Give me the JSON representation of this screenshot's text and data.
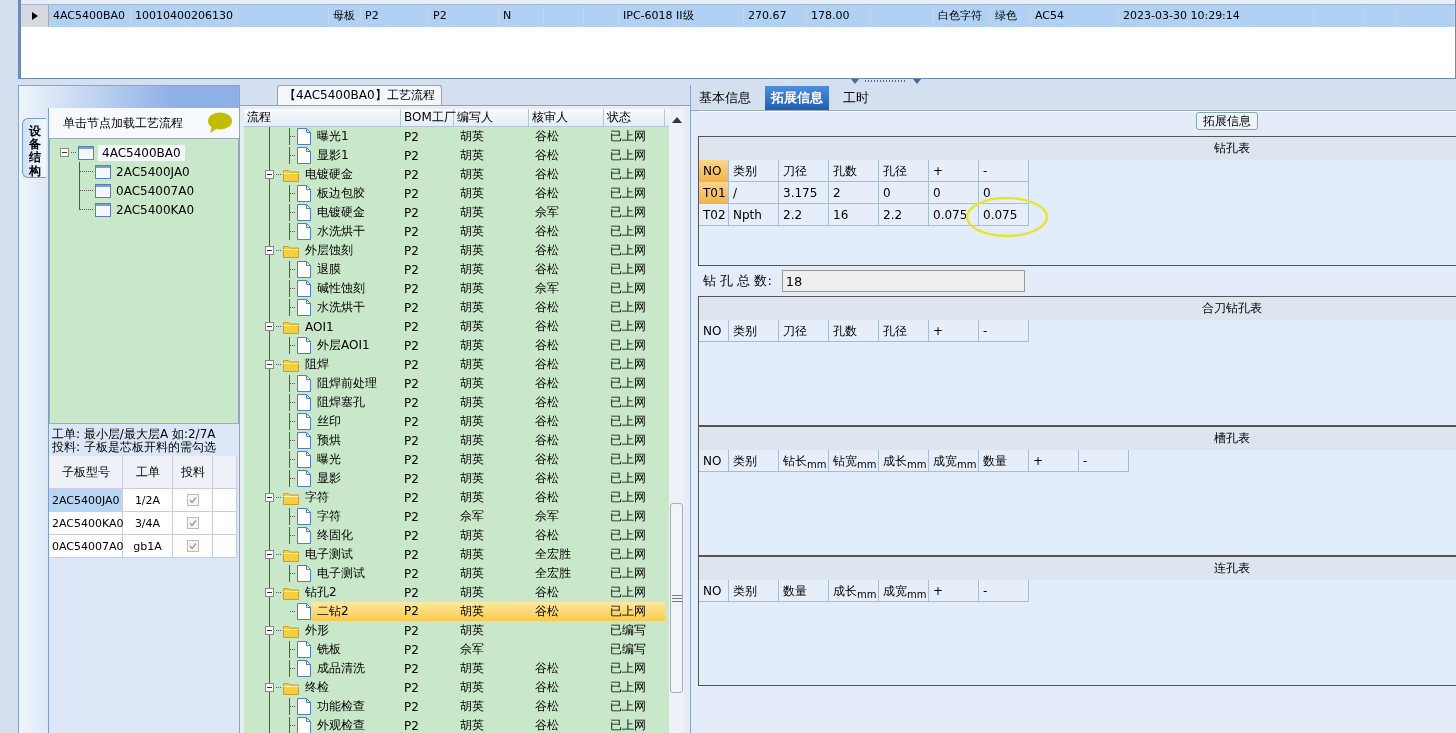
{
  "top_grid": {
    "rows": [
      {
        "selected": true,
        "cells": [
          "4AC5400BA0",
          "10010400206130",
          null,
          "母板",
          "P2",
          "P2",
          "N",
          null,
          null,
          "IPC-6018 II级",
          "270.67",
          "178.00",
          null,
          "白色字符",
          "绿色",
          "AC54",
          "2023-03-30 10:29:14",
          null,
          null,
          null
        ]
      }
    ]
  },
  "left_panel": {
    "vertical_tab": "设备结构",
    "hint": "单击节点加载工艺流程",
    "tree": {
      "label": "4AC5400BA0",
      "expanded": true,
      "children": [
        {
          "label": "2AC5400JA0"
        },
        {
          "label": "0AC54007A0"
        },
        {
          "label": "2AC5400KA0"
        }
      ]
    },
    "notes": [
      "工单: 最小层/最大层A 如:2/7A",
      "投料: 子板是芯板开料的需勾选"
    ],
    "sub_table": {
      "columns": [
        "子板型号",
        "工单",
        "投料"
      ],
      "rows": [
        {
          "model": "2AC5400JA0",
          "order": "1/2A",
          "checked": true,
          "selected": true
        },
        {
          "model": "2AC5400KA0",
          "order": "3/4A",
          "checked": true,
          "selected": false
        },
        {
          "model": "0AC54007A0",
          "order": "gb1A",
          "checked": true,
          "selected": false
        }
      ]
    }
  },
  "process": {
    "title": "【4AC5400BA0】工艺流程",
    "columns": [
      "流程",
      "BOM工厂",
      "编写人",
      "核审人",
      "状态"
    ],
    "rows": [
      {
        "kind": "file",
        "label": "曝光1",
        "bom": "P2",
        "writer": "胡英",
        "reviewer": "谷松",
        "status": "已上网",
        "selected": false
      },
      {
        "kind": "file",
        "label": "显影1",
        "bom": "P2",
        "writer": "胡英",
        "reviewer": "谷松",
        "status": "已上网",
        "selected": false
      },
      {
        "kind": "folder",
        "label": "电镀硬金",
        "bom": "P2",
        "writer": "胡英",
        "reviewer": "谷松",
        "status": "已上网",
        "selected": false,
        "expanded": true,
        "children": [
          {
            "kind": "file",
            "label": "板边包胶",
            "bom": "P2",
            "writer": "胡英",
            "reviewer": "谷松",
            "status": "已上网",
            "selected": false
          },
          {
            "kind": "file",
            "label": "电镀硬金",
            "bom": "P2",
            "writer": "胡英",
            "reviewer": "佘军",
            "status": "已上网",
            "selected": false
          },
          {
            "kind": "file",
            "label": "水洗烘干",
            "bom": "P2",
            "writer": "胡英",
            "reviewer": "谷松",
            "status": "已上网",
            "selected": false
          }
        ]
      },
      {
        "kind": "folder",
        "label": "外层蚀刻",
        "bom": "P2",
        "writer": "胡英",
        "reviewer": "谷松",
        "status": "已上网",
        "selected": false,
        "expanded": true,
        "children": [
          {
            "kind": "file",
            "label": "退膜",
            "bom": "P2",
            "writer": "胡英",
            "reviewer": "谷松",
            "status": "已上网",
            "selected": false
          },
          {
            "kind": "file",
            "label": "碱性蚀刻",
            "bom": "P2",
            "writer": "胡英",
            "reviewer": "佘军",
            "status": "已上网",
            "selected": false
          },
          {
            "kind": "file",
            "label": "水洗烘干",
            "bom": "P2",
            "writer": "胡英",
            "reviewer": "谷松",
            "status": "已上网",
            "selected": false
          }
        ]
      },
      {
        "kind": "folder",
        "label": "AOI1",
        "bom": "P2",
        "writer": "胡英",
        "reviewer": "谷松",
        "status": "已上网",
        "selected": false,
        "expanded": true,
        "children": [
          {
            "kind": "file",
            "label": "外层AOI1",
            "bom": "P2",
            "writer": "胡英",
            "reviewer": "谷松",
            "status": "已上网",
            "selected": false
          }
        ]
      },
      {
        "kind": "folder",
        "label": "阻焊",
        "bom": "P2",
        "writer": "胡英",
        "reviewer": "谷松",
        "status": "已上网",
        "selected": false,
        "expanded": true,
        "children": [
          {
            "kind": "file",
            "label": "阻焊前处理",
            "bom": "P2",
            "writer": "胡英",
            "reviewer": "谷松",
            "status": "已上网",
            "selected": false
          },
          {
            "kind": "file",
            "label": "阻焊塞孔",
            "bom": "P2",
            "writer": "胡英",
            "reviewer": "谷松",
            "status": "已上网",
            "selected": false
          },
          {
            "kind": "file",
            "label": "丝印",
            "bom": "P2",
            "writer": "胡英",
            "reviewer": "谷松",
            "status": "已上网",
            "selected": false
          },
          {
            "kind": "file",
            "label": "预烘",
            "bom": "P2",
            "writer": "胡英",
            "reviewer": "谷松",
            "status": "已上网",
            "selected": false
          },
          {
            "kind": "file",
            "label": "曝光",
            "bom": "P2",
            "writer": "胡英",
            "reviewer": "谷松",
            "status": "已上网",
            "selected": false
          },
          {
            "kind": "file",
            "label": "显影",
            "bom": "P2",
            "writer": "胡英",
            "reviewer": "谷松",
            "status": "已上网",
            "selected": false
          }
        ]
      },
      {
        "kind": "folder",
        "label": "字符",
        "bom": "P2",
        "writer": "胡英",
        "reviewer": "谷松",
        "status": "已上网",
        "selected": false,
        "expanded": true,
        "children": [
          {
            "kind": "file",
            "label": "字符",
            "bom": "P2",
            "writer": "佘军",
            "reviewer": "佘军",
            "status": "已上网",
            "selected": false
          },
          {
            "kind": "file",
            "label": "终固化",
            "bom": "P2",
            "writer": "胡英",
            "reviewer": "谷松",
            "status": "已上网",
            "selected": false
          }
        ]
      },
      {
        "kind": "folder",
        "label": "电子测试",
        "bom": "P2",
        "writer": "胡英",
        "reviewer": "全宏胜",
        "status": "已上网",
        "selected": false,
        "expanded": true,
        "children": [
          {
            "kind": "file",
            "label": "电子测试",
            "bom": "P2",
            "writer": "胡英",
            "reviewer": "全宏胜",
            "status": "已上网",
            "selected": false
          }
        ]
      },
      {
        "kind": "folder",
        "label": "钻孔2",
        "bom": "P2",
        "writer": "胡英",
        "reviewer": "谷松",
        "status": "已上网",
        "selected": false,
        "expanded": true,
        "children": [
          {
            "kind": "file",
            "label": "二钻2",
            "bom": "P2",
            "writer": "胡英",
            "reviewer": "谷松",
            "status": "已上网",
            "selected": true
          }
        ]
      },
      {
        "kind": "folder",
        "label": "外形",
        "bom": "P2",
        "writer": "胡英",
        "status": "已编写",
        "selected": false,
        "expanded": true,
        "children": [
          {
            "kind": "file",
            "label": "铣板",
            "bom": "P2",
            "writer": "佘军",
            "status": "已编写",
            "selected": false
          },
          {
            "kind": "file",
            "label": "成品清洗",
            "bom": "P2",
            "writer": "胡英",
            "reviewer": "谷松",
            "status": "已上网",
            "selected": false
          }
        ]
      },
      {
        "kind": "folder",
        "label": "终检",
        "bom": "P2",
        "writer": "胡英",
        "reviewer": "谷松",
        "status": "已上网",
        "selected": false,
        "expanded": true,
        "children": [
          {
            "kind": "file",
            "label": "功能检查",
            "bom": "P2",
            "writer": "胡英",
            "reviewer": "谷松",
            "status": "已上网",
            "selected": false
          },
          {
            "kind": "file",
            "label": "外观检查",
            "bom": "P2",
            "writer": "胡英",
            "reviewer": "谷松",
            "status": "已上网",
            "selected": false
          }
        ]
      }
    ]
  },
  "detail": {
    "tabs": [
      {
        "label": "基本信息",
        "selected": false
      },
      {
        "label": "拓展信息",
        "selected": true
      },
      {
        "label": "工时",
        "selected": false
      }
    ],
    "group_title": "拓展信息",
    "drill_table": {
      "title": "钻孔表",
      "columns": [
        "NO",
        "类别",
        "刀径",
        "孔数",
        "孔径",
        "+",
        "-"
      ],
      "rows": [
        {
          "cells": [
            "T01",
            "/",
            "3.175",
            "2",
            "0",
            "0",
            "0"
          ],
          "selected": true,
          "circled_last": false
        },
        {
          "cells": [
            "T02",
            "Npth",
            "2.2",
            "16",
            "2.2",
            "0.075",
            "0.075"
          ],
          "selected": false,
          "circled_last": true
        }
      ]
    },
    "total": {
      "label": "钻 孔 总 数:",
      "value": "18"
    },
    "sections": [
      {
        "title": "合刀钻孔表",
        "columns": [
          "NO",
          "类别",
          "刀径",
          "孔数",
          "孔径",
          "+",
          "-"
        ]
      },
      {
        "title": "槽孔表",
        "columns": [
          "NO",
          "类别",
          "钻长$_{mm}$",
          "钻宽$_{mm}$",
          "成长$_{mm}$",
          "成宽$_{mm}$",
          "数量",
          "+",
          "-"
        ]
      },
      {
        "title": "连孔表",
        "columns": [
          "NO",
          "类别",
          "数量",
          "成长$_{mm}$",
          "成宽$_{mm}$",
          "+",
          "-"
        ]
      }
    ]
  }
}
